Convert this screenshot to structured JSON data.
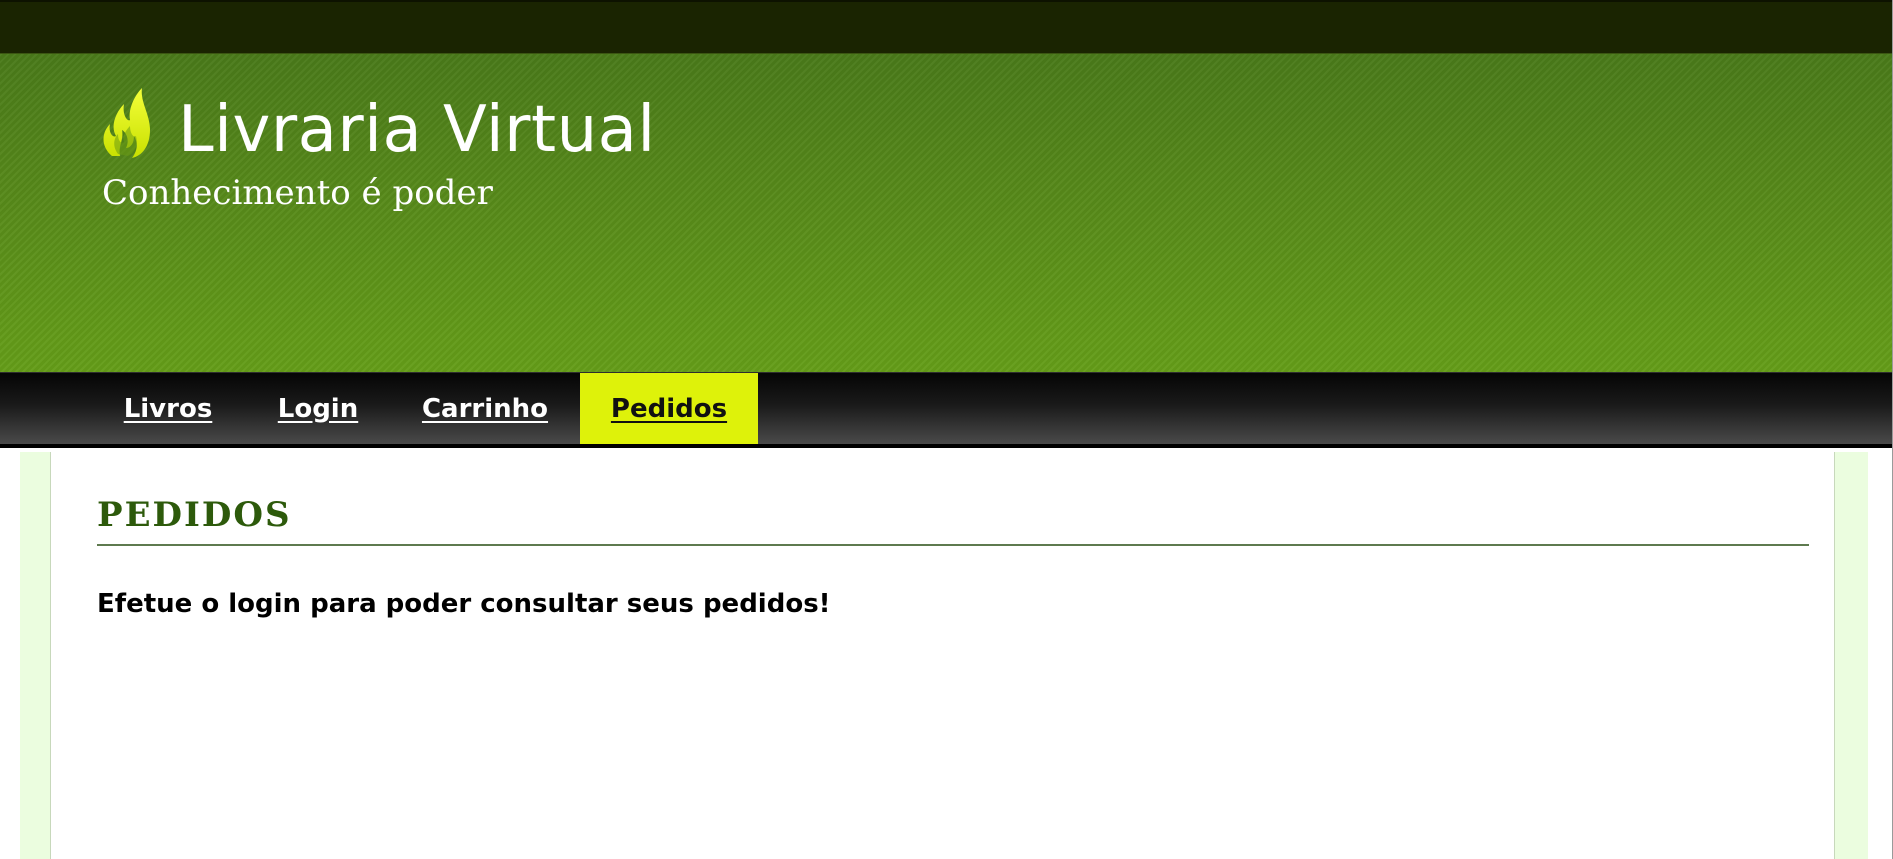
{
  "header": {
    "logo_icon": "flame-icon",
    "title": "Livraria Virtual",
    "tagline": "Conhecimento é poder"
  },
  "nav": {
    "items": [
      {
        "label": "Livros",
        "active": false
      },
      {
        "label": "Login",
        "active": false
      },
      {
        "label": "Carrinho",
        "active": false
      },
      {
        "label": "Pedidos",
        "active": true
      }
    ]
  },
  "main": {
    "section_title": "PEDIDOS",
    "message": "Efetue o login para poder consultar seus pedidos!"
  },
  "colors": {
    "topbar": "#1a2401",
    "header_green": "#578a1a",
    "nav_active": "#def20a",
    "section_title": "#2d5a0b",
    "content_bg": "#ebfddf"
  }
}
